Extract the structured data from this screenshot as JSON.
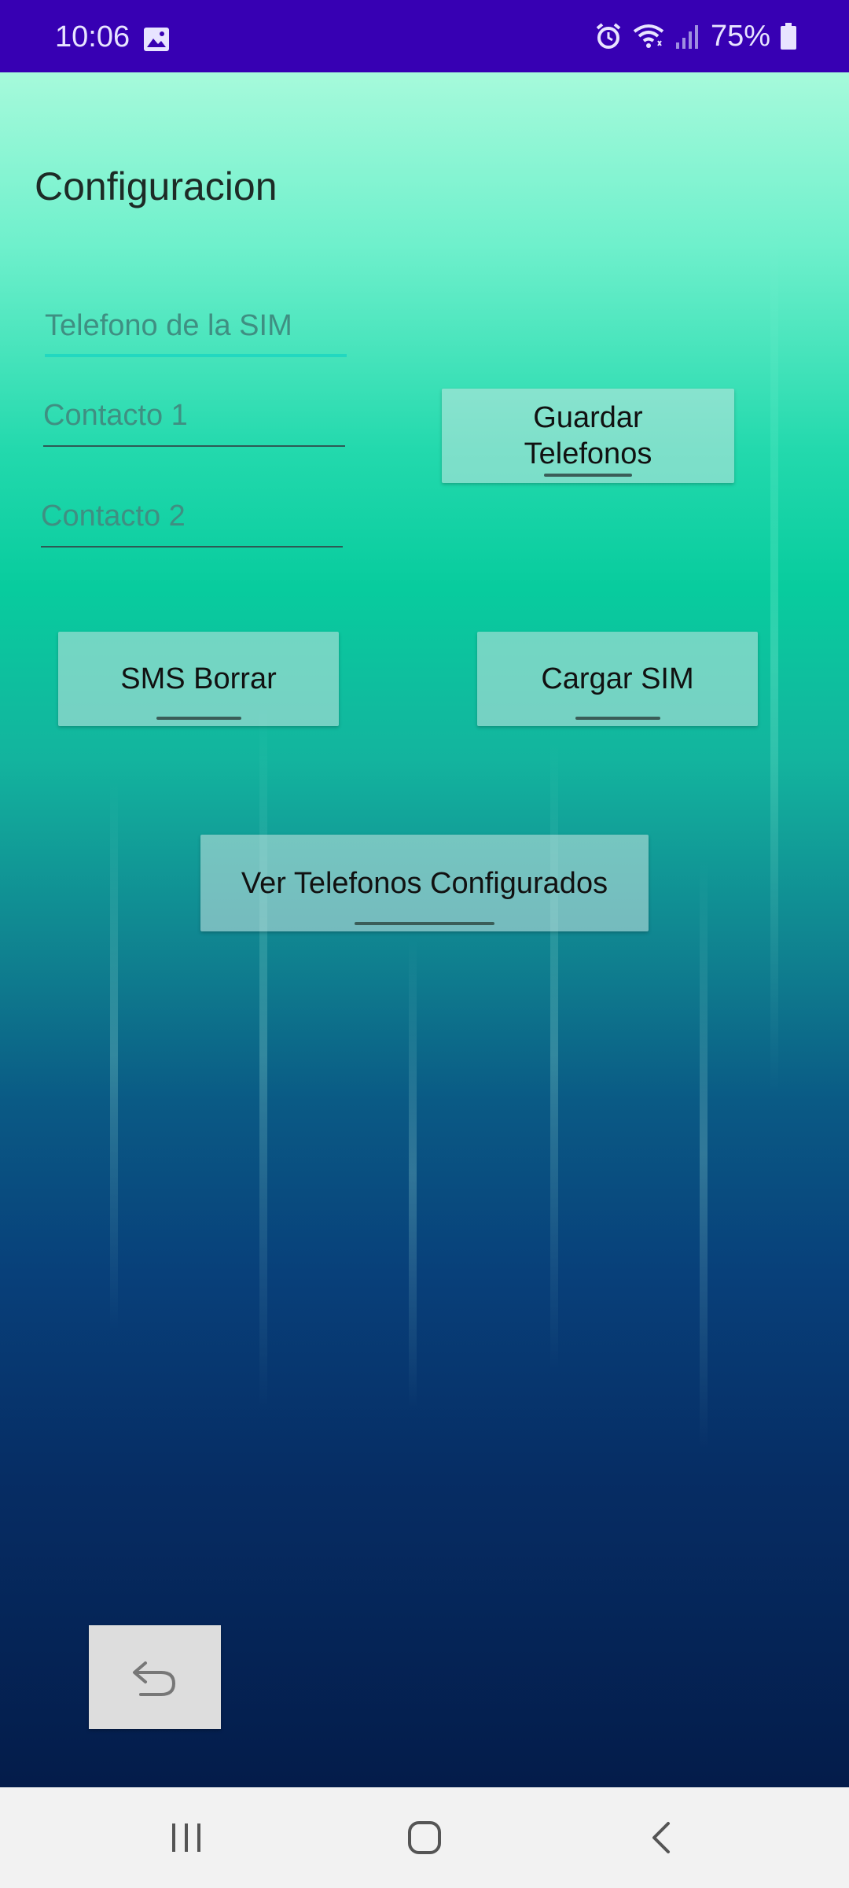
{
  "status_bar": {
    "time": "10:06",
    "battery_percent": "75%",
    "icons": [
      "image-icon",
      "alarm-icon",
      "wifi-icon",
      "signal-icon",
      "battery-icon"
    ]
  },
  "page": {
    "title": "Configuracion"
  },
  "form": {
    "sim_phone": {
      "placeholder": "Telefono de la SIM",
      "value": ""
    },
    "contact1": {
      "placeholder": "Contacto 1",
      "value": ""
    },
    "contact2": {
      "placeholder": "Contacto 2",
      "value": ""
    }
  },
  "buttons": {
    "save_phones_line1": "Guardar",
    "save_phones_line2": "Telefonos",
    "sms_delete": "SMS Borrar",
    "load_sim": "Cargar SIM",
    "view_configured": "Ver Telefonos Configurados"
  },
  "colors": {
    "status_bar": "#3700b3",
    "focus_accent": "#22d8c0"
  },
  "nav_bar": {
    "icons": [
      "recent-apps-icon",
      "home-icon",
      "back-nav-icon"
    ]
  }
}
